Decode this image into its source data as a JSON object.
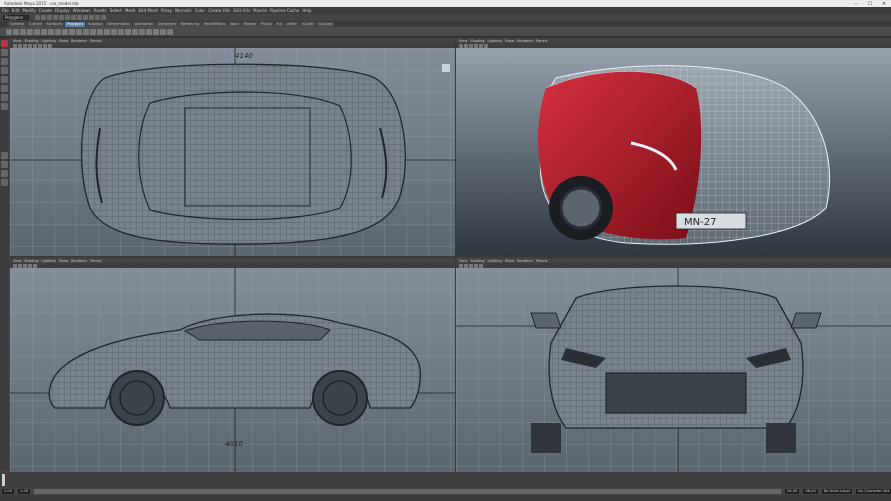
{
  "window": {
    "title": "Autodesk Maya 2015 - car_model.mb",
    "min_glyph": "–",
    "max_glyph": "☐",
    "close_glyph": "✕"
  },
  "menus": [
    "File",
    "Edit",
    "Modify",
    "Create",
    "Display",
    "Windows",
    "Assets",
    "Select",
    "Mesh",
    "Edit Mesh",
    "Proxy",
    "Normals",
    "Color",
    "Create UVs",
    "Edit UVs",
    "Muscle",
    "Pipeline Cache",
    "Help"
  ],
  "mode_selector": "Polygons",
  "shelf_tabs": [
    "General",
    "Curves",
    "Surfaces",
    "Polygons",
    "Subdivs",
    "Deformation",
    "Animation",
    "Dynamics",
    "Rendering",
    "PaintEffects",
    "Toon",
    "Muscle",
    "Fluids",
    "Fur",
    "nHair",
    "nCloth",
    "Custom"
  ],
  "active_shelf_tab": "Polygons",
  "viewport_menu": [
    "View",
    "Shading",
    "Lighting",
    "Show",
    "Renderer",
    "Panels"
  ],
  "viewports": {
    "top_left": {
      "name": "top",
      "sketch_label": "4140"
    },
    "top_right": {
      "name": "perspective",
      "plate_text": "MN-27"
    },
    "bottom_left": {
      "name": "side",
      "sketch_label": "4010"
    },
    "bottom_right": {
      "name": "front"
    }
  },
  "timeline": {
    "start": "1.00",
    "end": "24.00",
    "range_start": "1.00",
    "range_end": "48.00",
    "char_set": "No Character Set",
    "anim_layer": "No Anim Layer"
  },
  "colors": {
    "viewport_top": "#86909c",
    "viewport_bottom": "#5a6670",
    "car_red": "#b31e2c",
    "active_tab": "#5b7fa6"
  }
}
